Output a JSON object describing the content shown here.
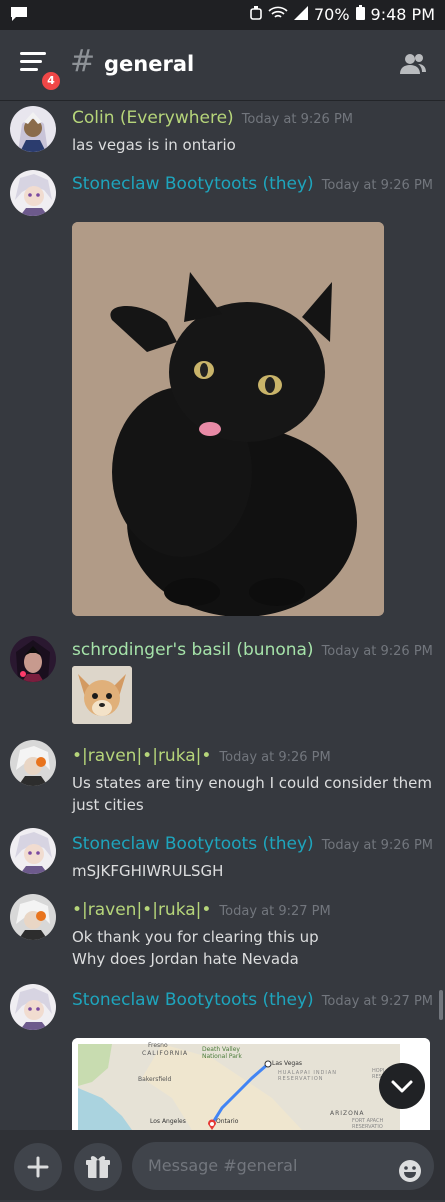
{
  "status": {
    "battery": "70%",
    "time": "9:48 PM"
  },
  "header": {
    "badge": "4",
    "hash": "#",
    "channel": "general"
  },
  "messages": [
    {
      "user": "Colin (Everywhere)",
      "time": "Today at 9:26 PM",
      "lines": [
        "las vegas is in ontario"
      ],
      "color": "#b6d57a"
    },
    {
      "user": "Stoneclaw Bootytoots (they)",
      "time": "Today at 9:26 PM",
      "color": "#1ea5bd"
    },
    {
      "user": "schrodinger's basil (bunona)",
      "time": "Today at 9:26 PM",
      "color": "#a5e2a9"
    },
    {
      "user": "•|raven|•|ruka|•",
      "time": "Today at 9:26 PM",
      "lines": [
        "Us states are tiny enough I could consider them",
        "just cities"
      ],
      "color": "#b6d57a"
    },
    {
      "user": "Stoneclaw Bootytoots (they)",
      "time": "Today at 9:26 PM",
      "lines": [
        "mSJKFGHIWRULSGH"
      ],
      "color": "#1ea5bd"
    },
    {
      "user": "•|raven|•|ruka|•",
      "time": "Today at 9:27 PM",
      "lines": [
        "Ok thank you for clearing this up",
        "Why does Jordan hate Nevada"
      ],
      "color": "#b6d57a"
    },
    {
      "user": "Stoneclaw Bootytoots (they)",
      "time": "Today at 9:27 PM",
      "color": "#1ea5bd"
    }
  ],
  "map": {
    "labels": {
      "fresno": "Fresno",
      "california": "CALIFORNIA",
      "death_valley_1": "Death Valley",
      "death_valley_2": "National Park",
      "las_vegas": "Las Vegas",
      "hualapai_1": "HUALAPAI INDIAN",
      "hualapai_2": "RESERVATION",
      "hopi": "HOPI",
      "reserv": "RESERV",
      "bakersfield": "Bakersfield",
      "los_angeles": "Los Angeles",
      "ontario": "Ontario",
      "arizona": "ARIZONA",
      "fort_apache_1": "FORT APACH",
      "fort_apache_2": "RESERVATIO"
    }
  },
  "input": {
    "placeholder": "Message #general"
  }
}
